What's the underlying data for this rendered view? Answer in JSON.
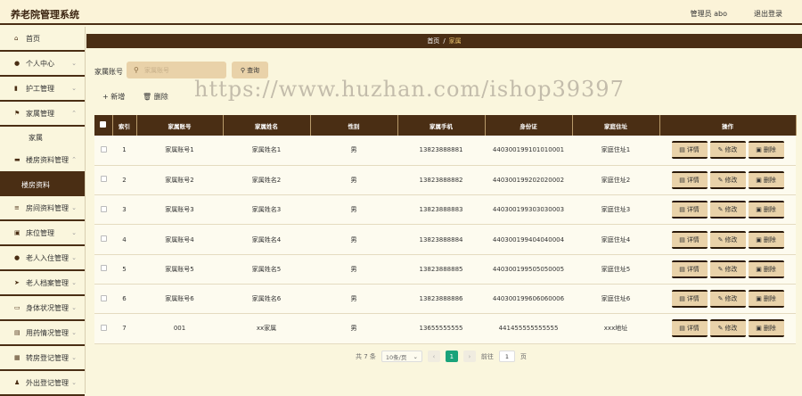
{
  "app": {
    "title": "养老院管理系统",
    "user": "管理员 abo",
    "logout": "退出登录"
  },
  "sidebar": {
    "items": [
      {
        "label": "首页",
        "icon": "home-icon",
        "glyph": "⌂"
      },
      {
        "label": "个人中心",
        "icon": "user-icon",
        "glyph": "●"
      },
      {
        "label": "护工管理",
        "icon": "chart-icon",
        "glyph": "▮"
      },
      {
        "label": "家属管理",
        "icon": "flag-icon",
        "glyph": "⚑"
      },
      {
        "label": "楼房资料管理",
        "icon": "chat-icon",
        "glyph": "▬"
      },
      {
        "label": "房间资料管理",
        "icon": "database-icon",
        "glyph": "≡"
      },
      {
        "label": "床位管理",
        "icon": "box-icon",
        "glyph": "▣"
      },
      {
        "label": "老人入住管理",
        "icon": "group-icon",
        "glyph": "●"
      },
      {
        "label": "老人档案管理",
        "icon": "send-icon",
        "glyph": "➤"
      },
      {
        "label": "身体状况管理",
        "icon": "monitor-icon",
        "glyph": "▭"
      },
      {
        "label": "用药情况管理",
        "icon": "list-icon",
        "glyph": "▤"
      },
      {
        "label": "转房登记管理",
        "icon": "grid-icon",
        "glyph": "▦"
      },
      {
        "label": "外出登记管理",
        "icon": "person-icon",
        "glyph": "♟"
      }
    ],
    "sub_family": "家属",
    "sub_building": "楼房资料"
  },
  "breadcrumb": {
    "home": "首页",
    "sep": "/",
    "current": "家属"
  },
  "search": {
    "label": "家属账号",
    "placeholder": "家属账号",
    "query_btn": "查询"
  },
  "toolbar": {
    "add": "+ 新增",
    "delete": "删除"
  },
  "table": {
    "headers": [
      "索引",
      "家属账号",
      "家属姓名",
      "性别",
      "家属手机",
      "身份证",
      "家庭住址",
      "操作"
    ],
    "rows": [
      {
        "idx": "1",
        "account": "家属账号1",
        "name": "家属姓名1",
        "gender": "男",
        "phone": "13823888881",
        "id_card": "440300199101010001",
        "address": "家庭住址1"
      },
      {
        "idx": "2",
        "account": "家属账号2",
        "name": "家属姓名2",
        "gender": "男",
        "phone": "13823888882",
        "id_card": "440300199202020002",
        "address": "家庭住址2"
      },
      {
        "idx": "3",
        "account": "家属账号3",
        "name": "家属姓名3",
        "gender": "男",
        "phone": "13823888883",
        "id_card": "440300199303030003",
        "address": "家庭住址3"
      },
      {
        "idx": "4",
        "account": "家属账号4",
        "name": "家属姓名4",
        "gender": "男",
        "phone": "13823888884",
        "id_card": "440300199404040004",
        "address": "家庭住址4"
      },
      {
        "idx": "5",
        "account": "家属账号5",
        "name": "家属姓名5",
        "gender": "男",
        "phone": "13823888885",
        "id_card": "440300199505050005",
        "address": "家庭住址5"
      },
      {
        "idx": "6",
        "account": "家属账号6",
        "name": "家属姓名6",
        "gender": "男",
        "phone": "13823888886",
        "id_card": "440300199606060006",
        "address": "家庭住址6"
      },
      {
        "idx": "7",
        "account": "001",
        "name": "xx家属",
        "gender": "男",
        "phone": "13655555555",
        "id_card": "441455555555555",
        "address": "xxx地址"
      }
    ],
    "actions": {
      "detail": "详情",
      "edit": "修改",
      "delete": "删除"
    }
  },
  "pagination": {
    "total": "共 7 条",
    "page_size": "10条/页",
    "current": "1",
    "goto": "前往",
    "goto_value": "1",
    "page_unit": "页"
  },
  "watermark": "https://www.huzhan.com/ishop39397"
}
